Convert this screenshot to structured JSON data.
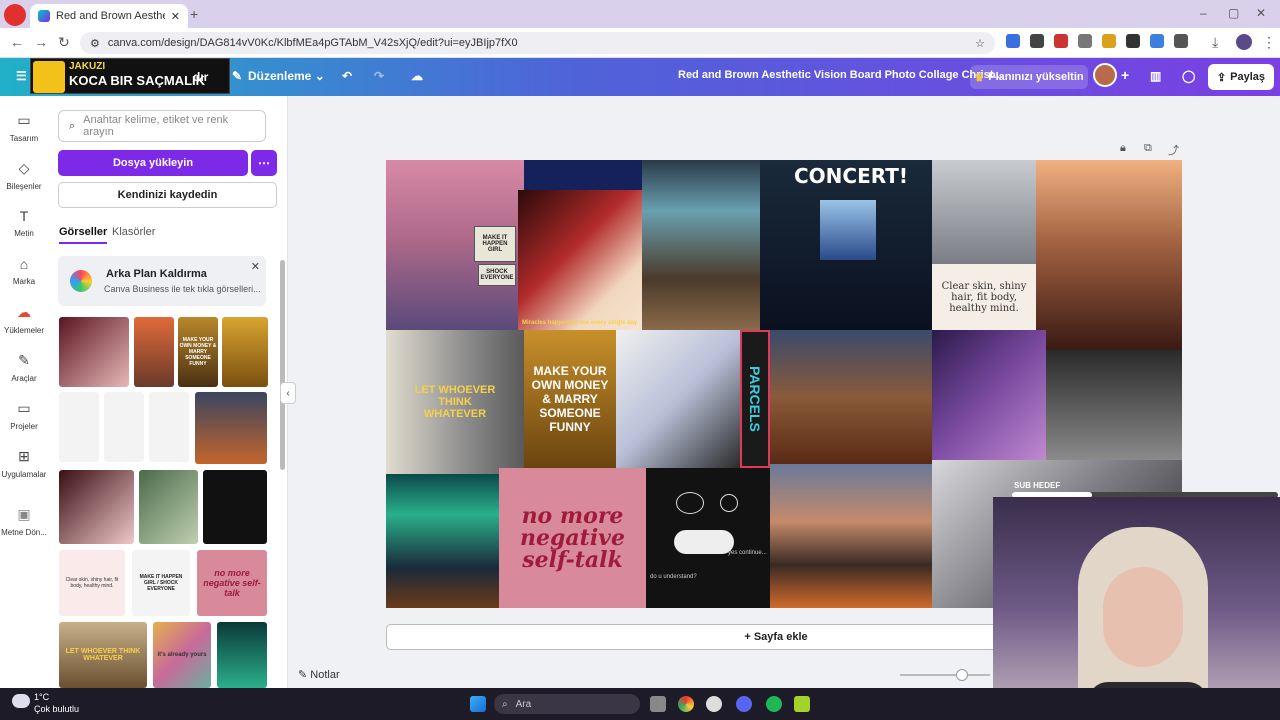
{
  "browser": {
    "tab_title": "Red and Brown Aesthetic Vi...",
    "url": "canva.com/design/DAG814vV0Kc/KlbfMEa4pGTAbM_V42sXjQ/edit?ui=eyJBIjp7fX0"
  },
  "overlay": {
    "top_label": "JAKUZI",
    "main_label": "KOCA BIR SAÇMALIK",
    "partial_suffix": "dır"
  },
  "header": {
    "edit_label": "Düzenleme",
    "doc_title": "Red and Brown Aesthetic Vision Board Photo Collage Christ...",
    "upgrade_label": "Planınızı yükseltin",
    "share_label": "Paylaş"
  },
  "rail": {
    "items": [
      {
        "label": "Tasarım",
        "icon": "layout-icon"
      },
      {
        "label": "Bileşenler",
        "icon": "shapes-icon"
      },
      {
        "label": "Metin",
        "icon": "text-icon"
      },
      {
        "label": "Marka",
        "icon": "brand-icon"
      },
      {
        "label": "Yüklemeler",
        "icon": "upload-icon"
      },
      {
        "label": "Araçlar",
        "icon": "draw-icon"
      },
      {
        "label": "Projeler",
        "icon": "folder-icon"
      },
      {
        "label": "Uygulamalar",
        "icon": "apps-icon"
      },
      {
        "label": "Metne Dön...",
        "icon": "text-convert-icon"
      }
    ]
  },
  "panel": {
    "search_placeholder": "Anahtar kelime, etiket ve renk arayın",
    "upload_label": "Dosya yükleyin",
    "record_label": "Kendinizi kaydedin",
    "tabs": [
      "Görseller",
      "Klasörler"
    ],
    "promo_title": "Arka Plan Kaldırma",
    "promo_text": "Canva Business ile tek tıkla görselleri...",
    "thumb_texts": {
      "t3": "MAKE YOUR OWN MONEY & MARRY SOMEONE FUNNY",
      "t10": "Clear skin, shiny hair, fit body, healthy mind.",
      "t11": "MAKE IT HAPPEN GIRL / SHOCK EVERYONE",
      "t12": "no more negative self-talk",
      "t13": "LET WHOEVER THINK WHATEVER",
      "t14": "it's already yours"
    }
  },
  "canvas": {
    "sign_top": "MAKE IT HAPPEN GIRL",
    "sign_bottom": "SHOCK EVERYONE",
    "miracles": "Miracles happen for me every single day",
    "concert": "CONCERT!",
    "affirmation": "Clear skin, shiny hair, fit body, healthy mind.",
    "let_whoever": "LET WHOEVER THINK WHATEVER",
    "money": "MAKE YOUR OWN MONEY & MARRY SOMEONE FUNNY",
    "parcels": "PARCELS",
    "no_more": "no more negative self-talk",
    "yes_continue": "yes continue...",
    "do_u": "do u understand?",
    "add_page": "+ Sayfa ekle",
    "notes": "Notlar"
  },
  "webcam": {
    "sub_label": "SUB HEDEF"
  },
  "taskbar": {
    "weather_temp": "1°C",
    "weather_desc": "Çok bulutlu",
    "search_label": "Ara"
  },
  "colors": {
    "accent": "#7d2ae8",
    "header_start": "#22b0c8",
    "header_end": "#7b3fe4"
  }
}
